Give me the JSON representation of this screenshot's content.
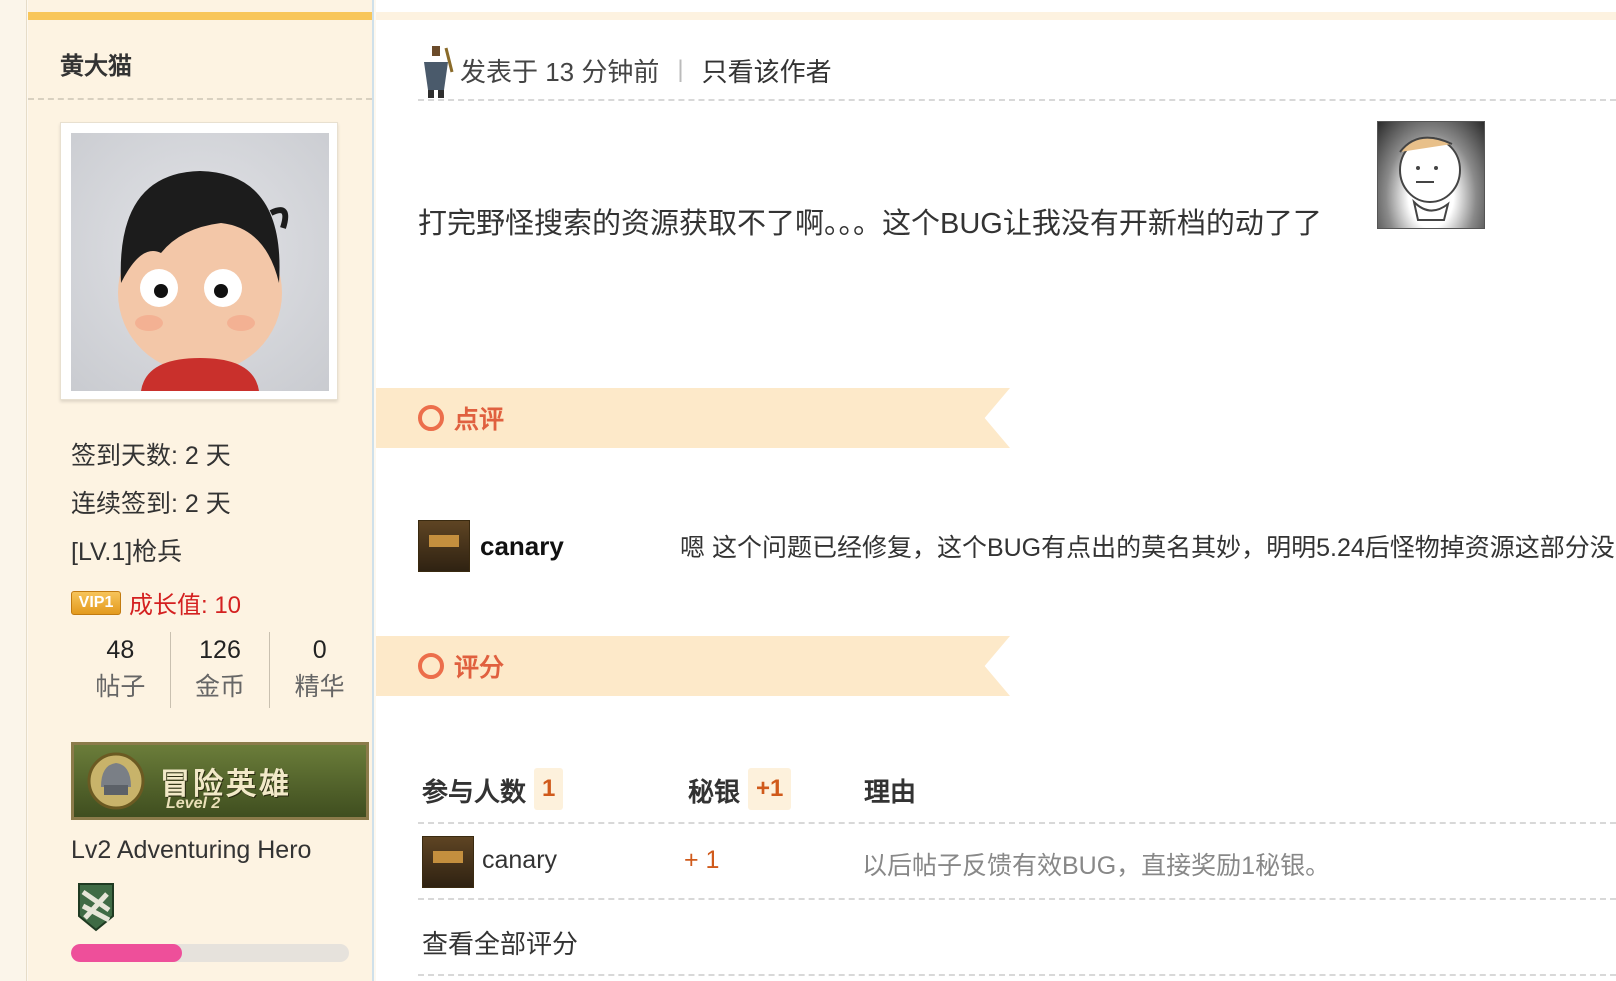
{
  "sidebar": {
    "author_name": "黄大猫",
    "checkin_days": "签到天数: 2 天",
    "streak_days": "连续签到: 2 天",
    "rank": "[LV.1]枪兵",
    "vip_badge": "VIP1",
    "growth": "成长值: 10",
    "counts": [
      {
        "value": "48",
        "label": "帖子"
      },
      {
        "value": "126",
        "label": "金币"
      },
      {
        "value": "0",
        "label": "精华"
      }
    ],
    "medal_title": "冒险英雄",
    "medal_level": "Level 2",
    "medal_caption": "Lv2 Adventuring Hero",
    "progress_fraction": 0.4,
    "colors": {
      "accent_bar": "#f8c65a",
      "progress": "#ee4f9a",
      "growth": "#d42020"
    }
  },
  "post": {
    "posted": "发表于 13 分钟前",
    "separator": "|",
    "only_author": "只看该作者",
    "body": "打完野怪搜索的资源获取不了啊。。。这个BUG让我没有开新档的动了了"
  },
  "comments_section": {
    "label": "点评",
    "items": [
      {
        "user": "canary",
        "text": "嗯 这个问题已经修复，这个BUG有点出的莫名其妙，明明5.24后怪物掉资源这部分没"
      }
    ]
  },
  "rating_section": {
    "label": "评分",
    "headers": {
      "participants": "参与人数",
      "participants_count": "1",
      "currency": "秘银",
      "currency_total": "+1",
      "reason": "理由"
    },
    "rows": [
      {
        "user": "canary",
        "amount": "+ 1",
        "reason": "以后帖子反馈有效BUG，直接奖励1秘银。"
      }
    ],
    "view_all": "查看全部评分"
  }
}
